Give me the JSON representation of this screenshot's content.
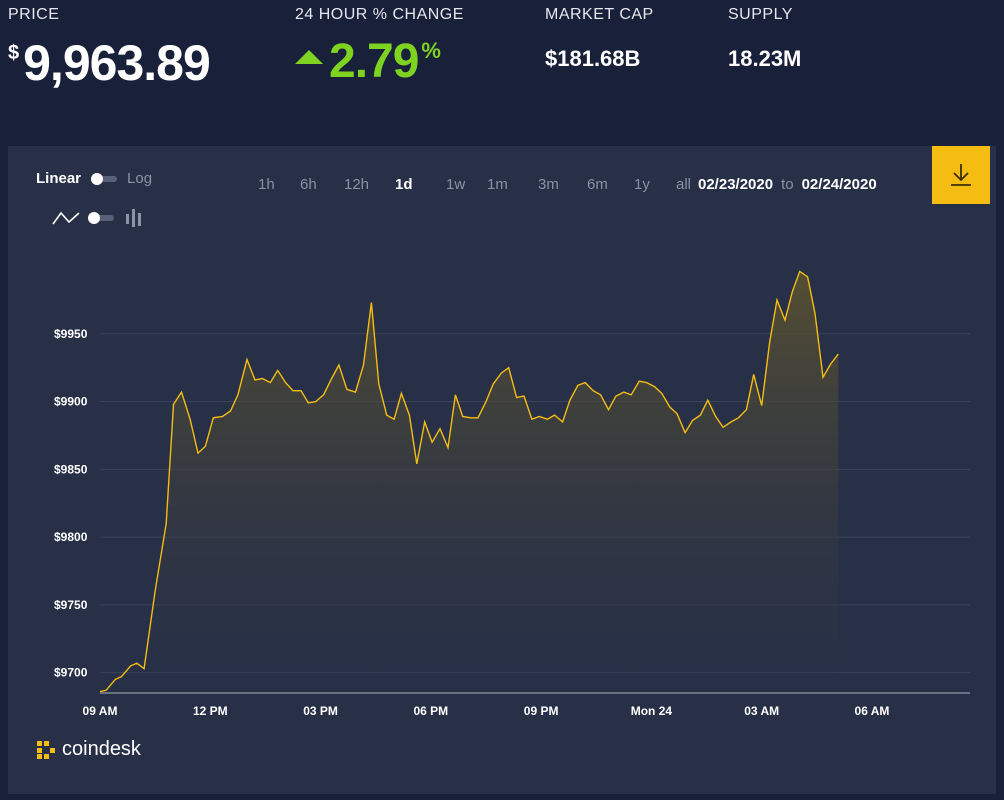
{
  "stats": {
    "price": {
      "label": "PRICE",
      "currency": "$",
      "value": "9,963.89"
    },
    "change": {
      "label": "24 HOUR % CHANGE",
      "value": "2.79",
      "unit": "%",
      "direction": "up",
      "color": "#7ed321"
    },
    "market_cap": {
      "label": "MARKET CAP",
      "value": "$181.68B"
    },
    "supply": {
      "label": "SUPPLY",
      "value": "18.23M"
    }
  },
  "controls": {
    "scale_linear": "Linear",
    "scale_log": "Log",
    "ranges": [
      "1h",
      "6h",
      "12h",
      "1d",
      "1w",
      "1m",
      "3m",
      "6m",
      "1y",
      "all"
    ],
    "active_range": "1d",
    "date_from": "02/23/2020",
    "date_sep": "to",
    "date_to": "02/24/2020",
    "download_icon": "download-icon",
    "accent_color": "#f5bc12"
  },
  "brand": {
    "name": "coindesk"
  },
  "chart_data": {
    "type": "area",
    "line_color": "#f5bc12",
    "ylim": [
      9685,
      10000
    ],
    "y_ticks": [
      9700,
      9750,
      9800,
      9850,
      9900,
      9950
    ],
    "y_tick_labels": [
      "$9700",
      "$9750",
      "$9800",
      "$9850",
      "$9900",
      "$9950"
    ],
    "x_ticks": [
      0,
      180,
      360,
      540,
      720,
      900,
      1080,
      1260
    ],
    "x_tick_labels": [
      "09 AM",
      "12 PM",
      "03 PM",
      "06 PM",
      "09 PM",
      "Mon 24",
      "03 AM",
      "06 AM"
    ],
    "xlim": [
      0,
      1420
    ],
    "grid": true,
    "points": [
      [
        0,
        9686
      ],
      [
        10,
        9687
      ],
      [
        25,
        9695
      ],
      [
        35,
        9697
      ],
      [
        50,
        9705
      ],
      [
        60,
        9707
      ],
      [
        72,
        9703
      ],
      [
        90,
        9760
      ],
      [
        108,
        9810
      ],
      [
        120,
        9898
      ],
      [
        133,
        9907
      ],
      [
        147,
        9887
      ],
      [
        160,
        9862
      ],
      [
        172,
        9867
      ],
      [
        185,
        9888
      ],
      [
        200,
        9889
      ],
      [
        213,
        9893
      ],
      [
        225,
        9905
      ],
      [
        240,
        9931
      ],
      [
        253,
        9916
      ],
      [
        265,
        9917
      ],
      [
        278,
        9914
      ],
      [
        290,
        9923
      ],
      [
        303,
        9914
      ],
      [
        315,
        9908
      ],
      [
        328,
        9908
      ],
      [
        340,
        9899
      ],
      [
        352,
        9900
      ],
      [
        365,
        9905
      ],
      [
        378,
        9917
      ],
      [
        390,
        9927
      ],
      [
        403,
        9909
      ],
      [
        417,
        9907
      ],
      [
        430,
        9927
      ],
      [
        443,
        9973
      ],
      [
        455,
        9913
      ],
      [
        468,
        9890
      ],
      [
        480,
        9887
      ],
      [
        492,
        9906
      ],
      [
        505,
        9890
      ],
      [
        517,
        9854
      ],
      [
        530,
        9885
      ],
      [
        542,
        9870
      ],
      [
        555,
        9880
      ],
      [
        568,
        9866
      ],
      [
        580,
        9905
      ],
      [
        592,
        9889
      ],
      [
        605,
        9888
      ],
      [
        617,
        9888
      ],
      [
        630,
        9900
      ],
      [
        642,
        9913
      ],
      [
        655,
        9921
      ],
      [
        667,
        9925
      ],
      [
        680,
        9903
      ],
      [
        692,
        9904
      ],
      [
        705,
        9887
      ],
      [
        717,
        9889
      ],
      [
        730,
        9887
      ],
      [
        742,
        9890
      ],
      [
        755,
        9885
      ],
      [
        767,
        9901
      ],
      [
        780,
        9912
      ],
      [
        792,
        9914
      ],
      [
        805,
        9908
      ],
      [
        817,
        9905
      ],
      [
        830,
        9894
      ],
      [
        842,
        9904
      ],
      [
        855,
        9907
      ],
      [
        867,
        9905
      ],
      [
        880,
        9915
      ],
      [
        892,
        9914
      ],
      [
        905,
        9911
      ],
      [
        917,
        9906
      ],
      [
        930,
        9896
      ],
      [
        942,
        9891
      ],
      [
        955,
        9877
      ],
      [
        967,
        9886
      ],
      [
        980,
        9890
      ],
      [
        992,
        9901
      ],
      [
        1005,
        9889
      ],
      [
        1017,
        9881
      ],
      [
        1030,
        9885
      ],
      [
        1042,
        9888
      ],
      [
        1055,
        9894
      ],
      [
        1067,
        9920
      ],
      [
        1080,
        9897
      ],
      [
        1093,
        9944
      ],
      [
        1105,
        9975
      ],
      [
        1118,
        9960
      ],
      [
        1130,
        9981
      ],
      [
        1142,
        9996
      ],
      [
        1155,
        9992
      ],
      [
        1167,
        9965
      ],
      [
        1180,
        9918
      ],
      [
        1193,
        9928
      ],
      [
        1205,
        9935
      ]
    ]
  }
}
